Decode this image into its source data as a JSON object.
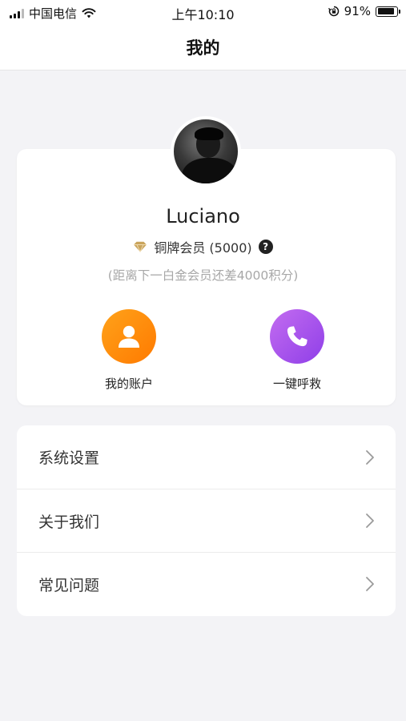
{
  "status_bar": {
    "carrier": "中国电信",
    "time": "上午10:10",
    "battery_percent": "91%",
    "battery_level": 0.91
  },
  "header": {
    "title": "我的"
  },
  "profile": {
    "username": "Luciano",
    "membership": "铜牌会员 (5000)",
    "help_symbol": "?",
    "upgrade_hint": "(距离下一白金会员还差4000积分)"
  },
  "actions": [
    {
      "label": "我的账户",
      "icon": "user-icon",
      "color": "#ff8a00"
    },
    {
      "label": "一键呼救",
      "icon": "phone-icon",
      "color": "#a550ee"
    }
  ],
  "menu": [
    {
      "label": "系统设置"
    },
    {
      "label": "关于我们"
    },
    {
      "label": "常见问题"
    }
  ],
  "colors": {
    "background": "#f3f3f6",
    "account_accent": "#ff8a00",
    "sos_accent": "#a550ee",
    "diamond": "#c9a45c"
  }
}
